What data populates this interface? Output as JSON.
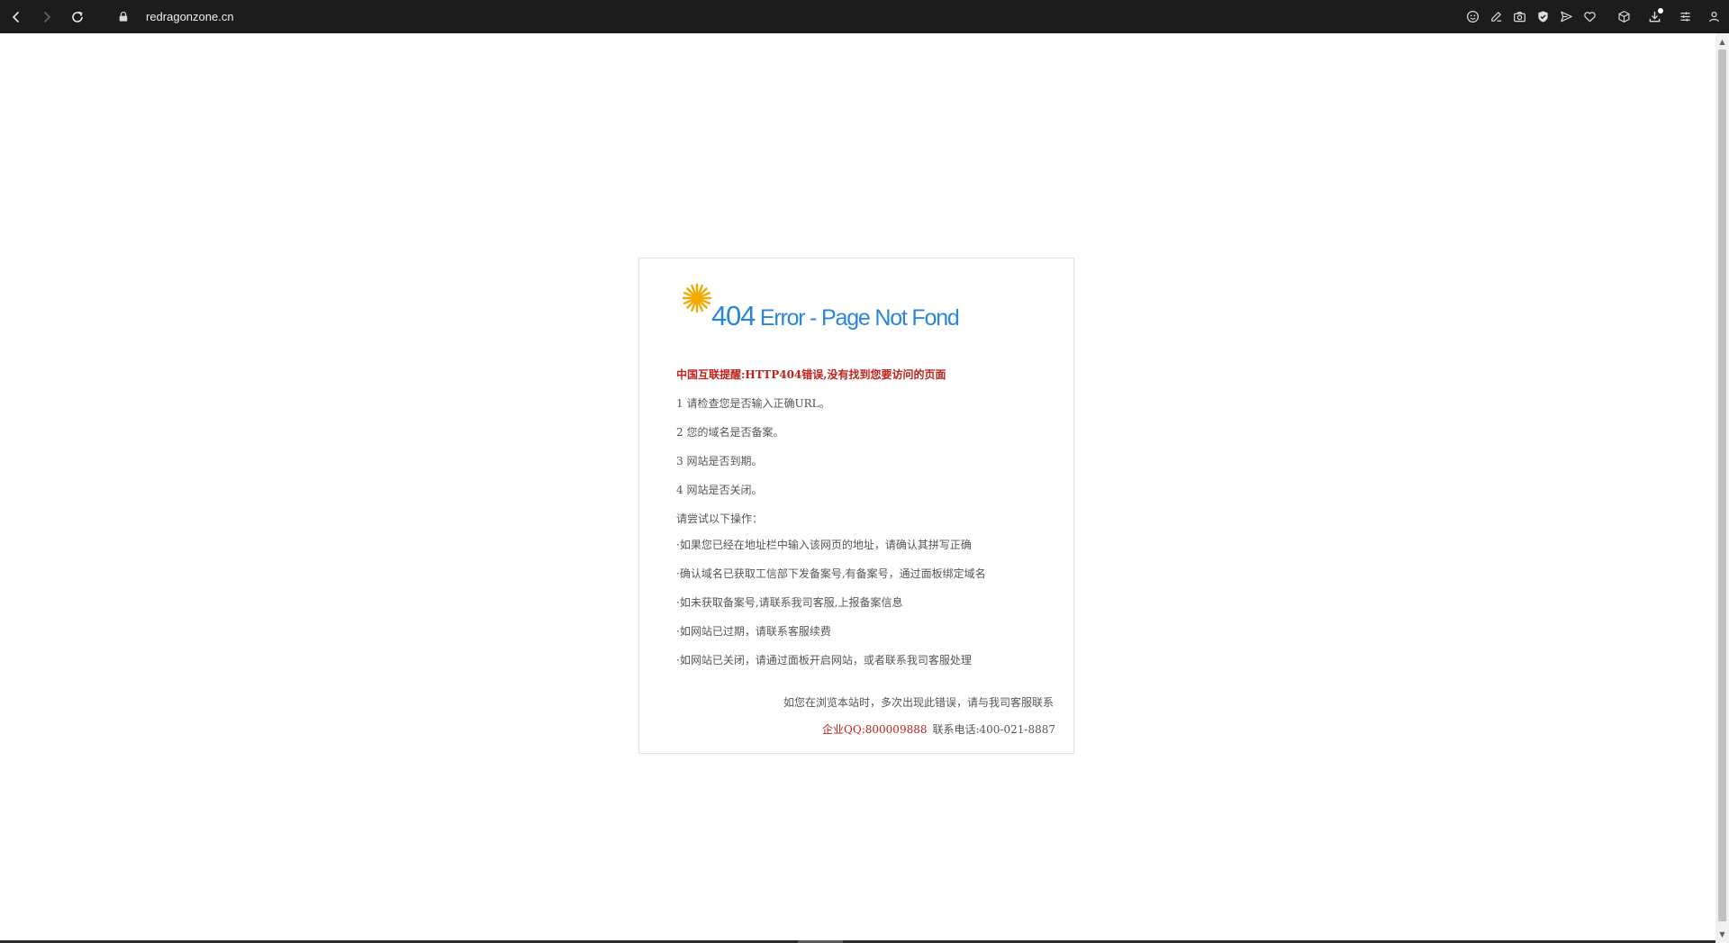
{
  "browser": {
    "url": "redragonzone.cn"
  },
  "error": {
    "title_number": "404",
    "title_rest": " Error - Page Not Fond",
    "warning": "中国互联提醒:HTTP404错误,没有找到您要访问的页面",
    "checks": [
      "1 请检查您是否输入正确URL。",
      "2 您的域名是否备案。",
      "3 网站是否到期。",
      "4 网站是否关闭。"
    ],
    "try_heading": "请尝试以下操作：",
    "actions": [
      "·如果您已经在地址栏中输入该网页的地址，请确认其拼写正确",
      "·确认域名已获取工信部下发备案号,有备案号，通过面板绑定域名",
      "·如未获取备案号,请联系我司客服,上报备案信息",
      "·如网站已过期，请联系客服续费",
      "·如网站已关闭，请通过面板开启网站，或者联系我司客服处理"
    ],
    "footer_note": "如您在浏览本站时，多次出现此错误，请与我司客服联系",
    "qq_link": "企业QQ:800009888",
    "phone": "联系电话:400-021-8887"
  }
}
